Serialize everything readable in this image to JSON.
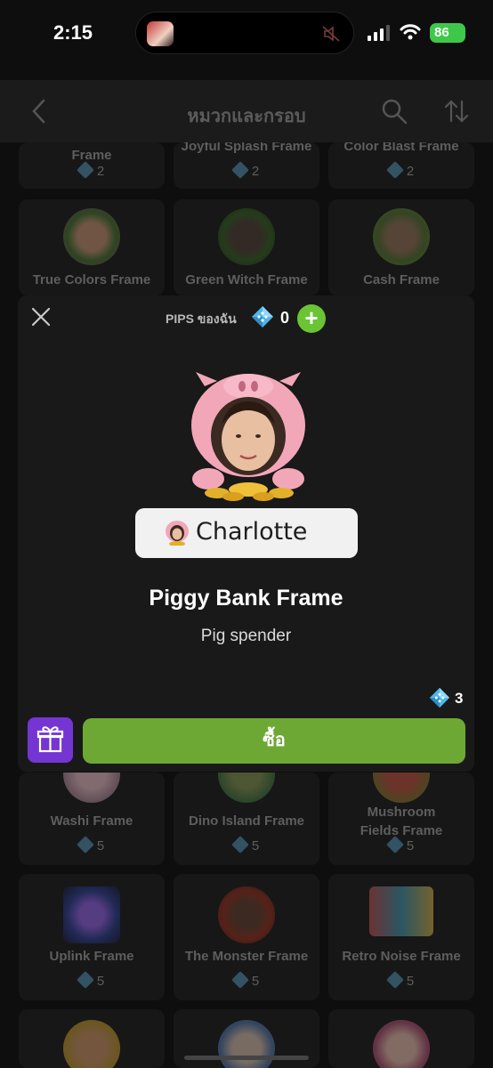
{
  "status_bar": {
    "time": "2:15",
    "battery": "86"
  },
  "header": {
    "title": "หมวกและกรอบ",
    "back_icon": "chevron-left-icon",
    "search_icon": "search-icon",
    "sort_icon": "sort-icon"
  },
  "grid": {
    "row1": [
      {
        "name": "Frame",
        "price": "2"
      },
      {
        "name": "Joyful Splash Frame",
        "price": "2"
      },
      {
        "name": "Color Blast Frame",
        "price": "2"
      }
    ],
    "row2": [
      {
        "name": "True Colors Frame"
      },
      {
        "name": "Green Witch Frame"
      },
      {
        "name": "Cash Frame"
      }
    ],
    "row3": [
      {
        "name": "Washi Frame",
        "price": "5"
      },
      {
        "name": "Dino Island Frame",
        "price": "5"
      },
      {
        "name_line1": "Mushroom",
        "name_line2": "Fields Frame",
        "price": "5"
      }
    ],
    "row4": [
      {
        "name": "Uplink Frame",
        "price": "5"
      },
      {
        "name": "The Monster Frame",
        "price": "5"
      },
      {
        "name": "Retro Noise Frame",
        "price": "5"
      }
    ]
  },
  "modal": {
    "pips_label": "PIPS ของฉัน",
    "pips_count": "0",
    "add_label": "+",
    "name_tag": "Charlotte",
    "frame_title": "Piggy Bank Frame",
    "frame_desc": "Pig spender",
    "price": "3",
    "buy_label": "ซื้อ"
  },
  "colors": {
    "buy_button": "#6da835",
    "gift_button": "#7535d2",
    "add_button": "#6bc433",
    "gem": "#4fb6e8"
  }
}
